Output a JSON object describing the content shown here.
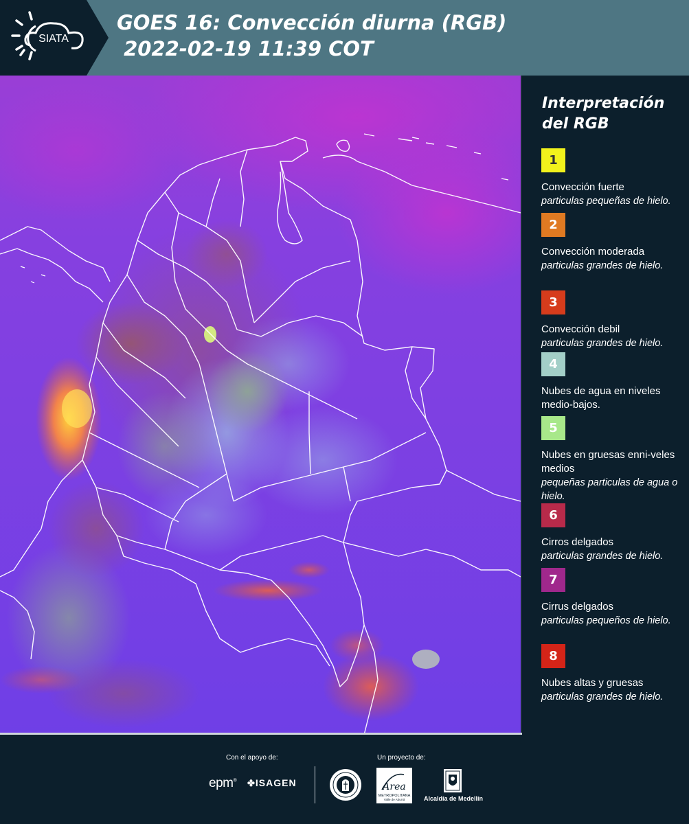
{
  "header": {
    "logo_text": "SIATA",
    "title_line1": "GOES 16: Convección diurna (RGB)",
    "title_line2": " 2022-02-19 11:39 COT"
  },
  "legend": {
    "title": "Interpretación del RGB",
    "items": [
      {
        "number": "1",
        "color": "#f2f21c",
        "text_color": "#333333",
        "title": "Convección fuerte",
        "subtitle": "particulas pequeñas de hielo."
      },
      {
        "number": "2",
        "color": "#e07a22",
        "text_color": "#ffffff",
        "title": "Convección moderada",
        "subtitle": "particulas grandes de hielo."
      },
      {
        "number": "3",
        "color": "#d63c1c",
        "text_color": "#ffffff",
        "title": "Convección debil",
        "subtitle": "particulas grandes de hielo."
      },
      {
        "number": "4",
        "color": "#a3cfc8",
        "text_color": "#ffffff",
        "title": "Nubes de agua en niveles medio-bajos.",
        "subtitle": ""
      },
      {
        "number": "5",
        "color": "#a8e88a",
        "text_color": "#ffffff",
        "title": "Nubes en gruesas enni-veles medios",
        "subtitle": "pequeñas particulas de agua o hielo."
      },
      {
        "number": "6",
        "color": "#b82a4a",
        "text_color": "#ffffff",
        "title": "Cirros delgados",
        "subtitle": "particulas grandes de hielo."
      },
      {
        "number": "7",
        "color": "#a0288c",
        "text_color": "#ffffff",
        "title": "Cirrus delgados",
        "subtitle": "particulas pequeños de hielo."
      },
      {
        "number": "8",
        "color": "#d42418",
        "text_color": "#ffffff",
        "title": "Nubes altas y gruesas",
        "subtitle": "particulas grandes de hielo."
      }
    ]
  },
  "footer": {
    "support_label": "Con el apoyo de:",
    "project_label": "Un proyecto de:",
    "sponsor_epm": "epm",
    "sponsor_isagen": "ISAGEN",
    "area_name": "Área",
    "area_subtitle": "METROPOLITANA",
    "area_subtitle2": "Valle de Aburrá",
    "alcaldia": "Alcaldía de Medellín"
  },
  "colors": {
    "header_bg": "#4e7683",
    "logo_bg": "#0c1f2c",
    "panel_bg": "#0c1f2c",
    "map_base": "#7d3fe0"
  }
}
